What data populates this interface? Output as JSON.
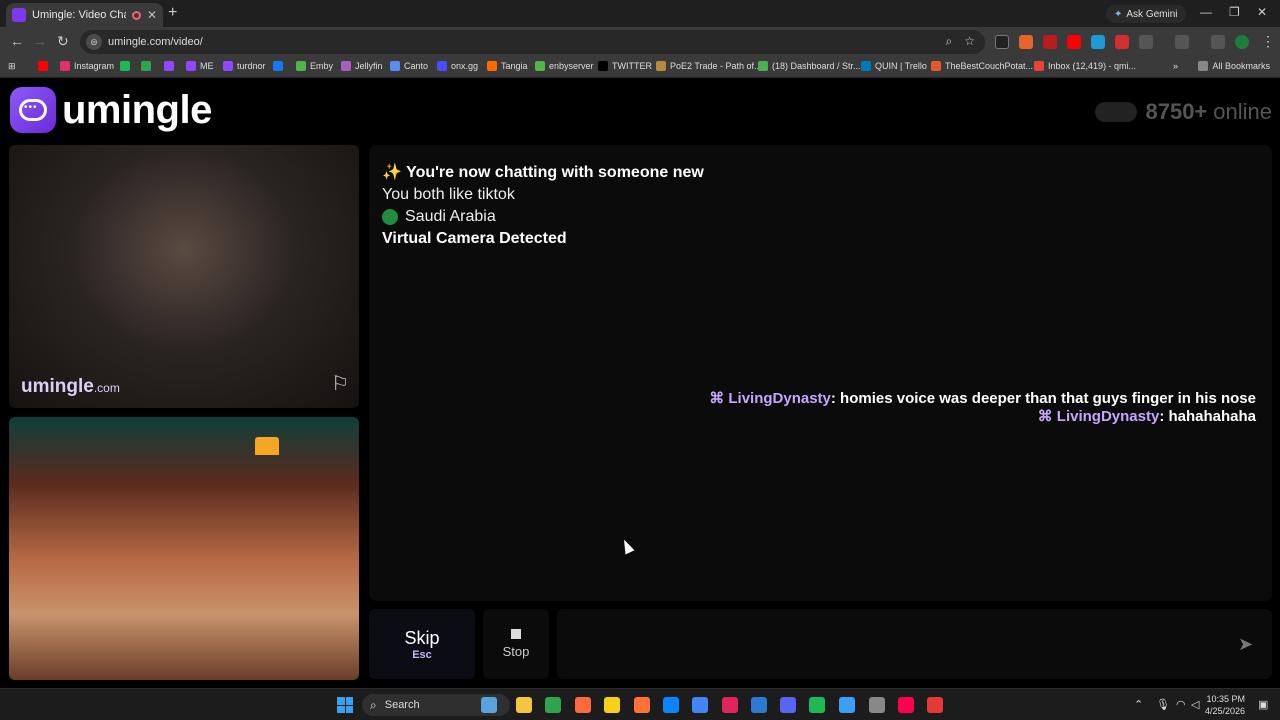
{
  "browser": {
    "tab_title": "Umingle: Video Chat with S",
    "new_tab_glyph": "+",
    "close_glyph": "✕",
    "ask_gemini": "Ask Gemini",
    "url": "umingle.com/video/",
    "bookmarks": [
      {
        "label": "",
        "color": "#ff0000"
      },
      {
        "label": "Instagram",
        "color": "#e1306c"
      },
      {
        "label": "",
        "color": "#1db954"
      },
      {
        "label": "",
        "color": "#2ea44f"
      },
      {
        "label": "",
        "color": "#9146ff"
      },
      {
        "label": "ME",
        "color": "#9146ff"
      },
      {
        "label": "turdnor",
        "color": "#9146ff"
      },
      {
        "label": "",
        "color": "#1877f2"
      },
      {
        "label": "Emby",
        "color": "#52b54b"
      },
      {
        "label": "Jellyfin",
        "color": "#aa5cc3"
      },
      {
        "label": "Canto",
        "color": "#5b8def"
      },
      {
        "label": "onx.gg",
        "color": "#4b4bff"
      },
      {
        "label": "Tangia",
        "color": "#ff6a00"
      },
      {
        "label": "enbyserver",
        "color": "#52b54b"
      },
      {
        "label": "TWITTER",
        "color": "#000000"
      },
      {
        "label": "PoE2 Trade - Path of...",
        "color": "#b58a3a"
      },
      {
        "label": "(18) Dashboard / Str...",
        "color": "#4caf50"
      },
      {
        "label": "QUIN | Trello",
        "color": "#0079bf"
      },
      {
        "label": "TheBestCouchPotat...",
        "color": "#e05a2b"
      },
      {
        "label": "Inbox (12,419) - qmi...",
        "color": "#ea4335"
      }
    ],
    "all_bookmarks": "All Bookmarks"
  },
  "site": {
    "brand": "umingle",
    "online_count": "8750+",
    "online_label": "online",
    "watermark_main": "umingle",
    "watermark_suffix": ".com"
  },
  "chat": {
    "system_lines": {
      "new_chat": "✨ You're now chatting with someone new",
      "interest": "You both like tiktok",
      "country": "Saudi Arabia",
      "camera": "Virtual Camera Detected"
    },
    "messages": [
      {
        "user": "LivingDynasty",
        "text": ": homies voice was deeper than that guys finger in his nose"
      },
      {
        "user": "LivingDynasty",
        "text": ": hahahahaha"
      }
    ],
    "message_input_placeholder": ""
  },
  "controls": {
    "skip_label": "Skip",
    "skip_hint": "Esc",
    "stop_label": "Stop"
  },
  "taskbar": {
    "search_label": "Search",
    "time": "10:35 PM",
    "date": "4/25/2026",
    "pinned_colors": [
      "#5ba3e0",
      "#f5c542",
      "#2ea44f",
      "#ff6a3d",
      "#f7d117",
      "#ff7139",
      "#0a84ff",
      "#4285f4",
      "#e0245e",
      "#2b7bd5",
      "#5865f2",
      "#1db954",
      "#3aa0f5",
      "#888888",
      "#ff0050",
      "#e53935"
    ]
  },
  "colors": {
    "brand_purple": "#7c3aed",
    "username_purple": "#c4a6ff"
  }
}
